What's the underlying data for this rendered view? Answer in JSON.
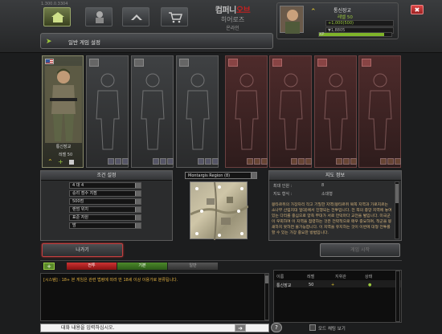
{
  "header": {
    "version": "1.300.0.3304",
    "logo_line1": "컴퍼니",
    "logo_line1_red": "오브",
    "logo_line2": "히어로즈",
    "logo_line3": "온라인",
    "room_title": "일반 게임 설정"
  },
  "profile": {
    "name": "통신장교",
    "level": "레벨 50",
    "money": "+1,000(500)",
    "money2": "▼1,8805",
    "xp_label": "XP",
    "xp_fraction": 0.9,
    "close_icon": "✖"
  },
  "player_slot": {
    "name": "통신장교",
    "level": "레벨 50",
    "flag": "us-flag-icon"
  },
  "conditions": {
    "title": "조건 설정",
    "rows": [
      "4 대 4",
      "승리 점수 지점",
      "500점",
      "랜덤 위치",
      "표준 자원",
      "밤"
    ]
  },
  "map": {
    "selected": "Montargis Region (8)"
  },
  "info": {
    "title": "지도 정보",
    "max_players_label": "최대 인원 :",
    "max_players": "8",
    "terrain_label": "지도 형식 :",
    "terrain": "소대형",
    "description": "몽타르쥐의 가장자리 작고 기밀한 지역(몽타르쥐 북쪽 지역과 가로지르는 소나무 산림지대 일대)에서 진행되는 전투입니다. 전 쪽의 중앙 지역에 놓여 있는 다리를 중심으로 양측 부대가 서로 언덕마다 교전을 벌입니다. 미국군이 우회하여 이 지역을 점령하는 것은 전략적으로 매우 중요하며, 적군을 봉쇄하지 못하면 불가능합니다. 이 지역을 유지하는 것이 이번에 대형 전투를 할 수 있는 가장 중요한 방법입니다."
  },
  "buttons": {
    "leave": "나가기",
    "start": "게임 시작"
  },
  "chat": {
    "tabs": [
      "전투",
      "기본",
      "일반"
    ],
    "message": "[시스템] : 18+ 본 게임은 관련 법령에 따라 만 18세 이상 이용가로 분류됩니다.",
    "input_placeholder": "대화 내용을 입력하십시오.",
    "add_icon": "+"
  },
  "userlist": {
    "headers": [
      "이름",
      "레벨",
      "지휘관",
      "상태"
    ],
    "rows": [
      {
        "name": "통신장교",
        "level": "50",
        "commander": "+",
        "status": "●"
      }
    ]
  },
  "footer": {
    "checkbox_label": "모드 채팅 보기"
  }
}
